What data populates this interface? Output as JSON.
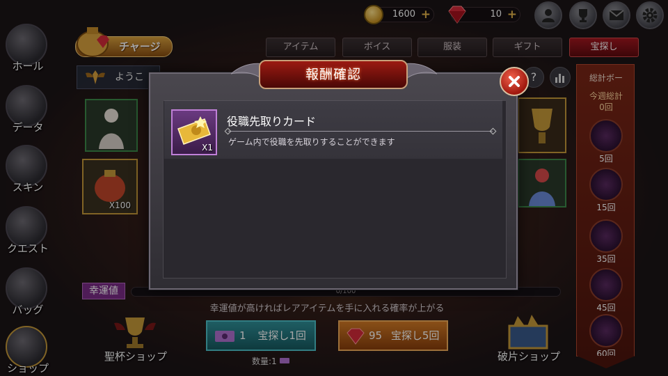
{
  "resources": {
    "coins": "1600",
    "gems": "10"
  },
  "charge_button": "チャージ",
  "tabs": [
    {
      "label": "アイテム",
      "active": false
    },
    {
      "label": "ボイス",
      "active": false
    },
    {
      "label": "服装",
      "active": false
    },
    {
      "label": "ギフト",
      "active": false
    },
    {
      "label": "宝探し",
      "active": true
    }
  ],
  "welcome_text": "ようこ",
  "left_nav": [
    {
      "label": "ホール",
      "icon": "hall-icon"
    },
    {
      "label": "データ",
      "icon": "data-icon"
    },
    {
      "label": "スキン",
      "icon": "skin-icon"
    },
    {
      "label": "クエスト",
      "icon": "quest-icon"
    },
    {
      "label": "バッグ",
      "icon": "bag-icon"
    },
    {
      "label": "ショップ",
      "icon": "shop-icon"
    }
  ],
  "side_panel": {
    "title": "総計ボー",
    "weekly_label": "今週総計",
    "weekly_value": "0回",
    "milestones": [
      "5回",
      "15回",
      "35回",
      "45回",
      "60回"
    ]
  },
  "bg_cards": [
    {
      "count": "X100"
    }
  ],
  "luck": {
    "label": "幸運値",
    "progress_text": "0/100",
    "progress": 0,
    "description": "幸運値が高ければレアアイテムを手に入れる確率が上がる"
  },
  "shops": {
    "left": "聖杯ショップ",
    "right": "破片ショップ"
  },
  "hunt_buttons": {
    "once_cost": "1",
    "once_label": "宝探し1回",
    "five_cost": "95",
    "five_label": "宝探し5回",
    "quantity_text": "数量:1"
  },
  "modal": {
    "title": "報酬確認",
    "reward": {
      "name": "役職先取りカード",
      "quantity": "X1",
      "description": "ゲーム内で役職を先取りすることができます"
    }
  },
  "colors": {
    "accent_red": "#a31720",
    "luck_purple": "#7a2c86",
    "teal_button": "#2f8f98",
    "orange_button": "#d27a25"
  }
}
